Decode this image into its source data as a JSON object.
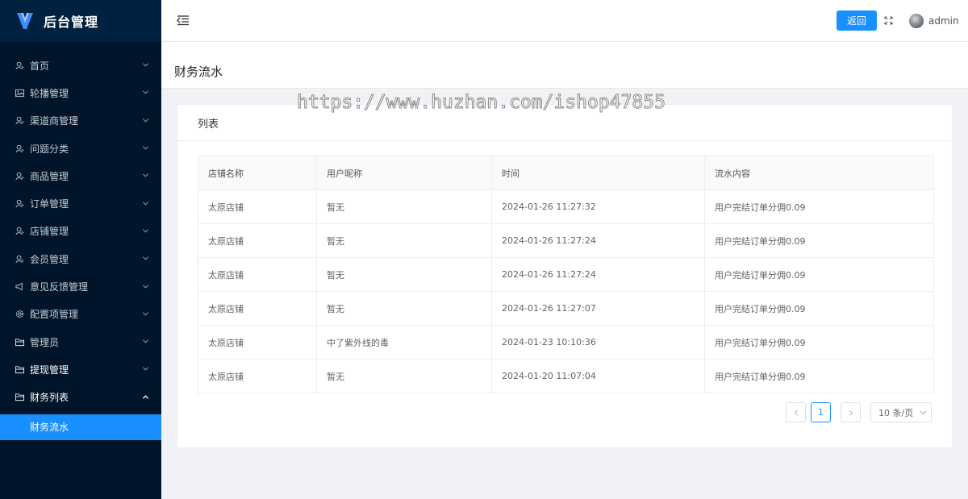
{
  "app": {
    "title": "后台管理"
  },
  "sidebar": {
    "items": [
      {
        "label": "首页",
        "icon": "user-icon"
      },
      {
        "label": "轮播管理",
        "icon": "image-icon"
      },
      {
        "label": "渠道商管理",
        "icon": "user-icon"
      },
      {
        "label": "问题分类",
        "icon": "user-icon"
      },
      {
        "label": "商品管理",
        "icon": "user-icon"
      },
      {
        "label": "订单管理",
        "icon": "user-icon"
      },
      {
        "label": "店铺管理",
        "icon": "user-icon"
      },
      {
        "label": "会员管理",
        "icon": "user-icon"
      },
      {
        "label": "意见反馈管理",
        "icon": "megaphone-icon"
      },
      {
        "label": "配置项管理",
        "icon": "gear-icon"
      },
      {
        "label": "管理员",
        "icon": "folder-icon"
      },
      {
        "label": "提现管理",
        "icon": "folder-icon"
      },
      {
        "label": "财务列表",
        "icon": "folder-icon"
      }
    ],
    "active_sub": "财务流水"
  },
  "header": {
    "back_label": "返回",
    "username": "admin"
  },
  "page": {
    "title": "财务流水"
  },
  "card": {
    "title": "列表"
  },
  "table": {
    "headers": [
      "店铺名称",
      "用户昵称",
      "时间",
      "流水内容"
    ],
    "rows": [
      [
        "太原店铺",
        "暂无",
        "2024-01-26 11:27:32",
        "用户完结订单分佣0.09"
      ],
      [
        "太原店铺",
        "暂无",
        "2024-01-26 11:27:24",
        "用户完结订单分佣0.09"
      ],
      [
        "太原店铺",
        "暂无",
        "2024-01-26 11:27:24",
        "用户完结订单分佣0.09"
      ],
      [
        "太原店铺",
        "暂无",
        "2024-01-26 11:27:07",
        "用户完结订单分佣0.09"
      ],
      [
        "太原店铺",
        "中了紫外线的毒",
        "2024-01-23 10:10:36",
        "用户完结订单分佣0.09"
      ],
      [
        "太原店铺",
        "暂无",
        "2024-01-20 11:07:04",
        "用户完结订单分佣0.09"
      ]
    ]
  },
  "pagination": {
    "current_page": "1",
    "page_size": "10 条/页"
  },
  "watermark": "https://www.huzhan.com/ishop47855",
  "colors": {
    "sidebar_bg": "#001529",
    "accent": "#1890ff"
  }
}
